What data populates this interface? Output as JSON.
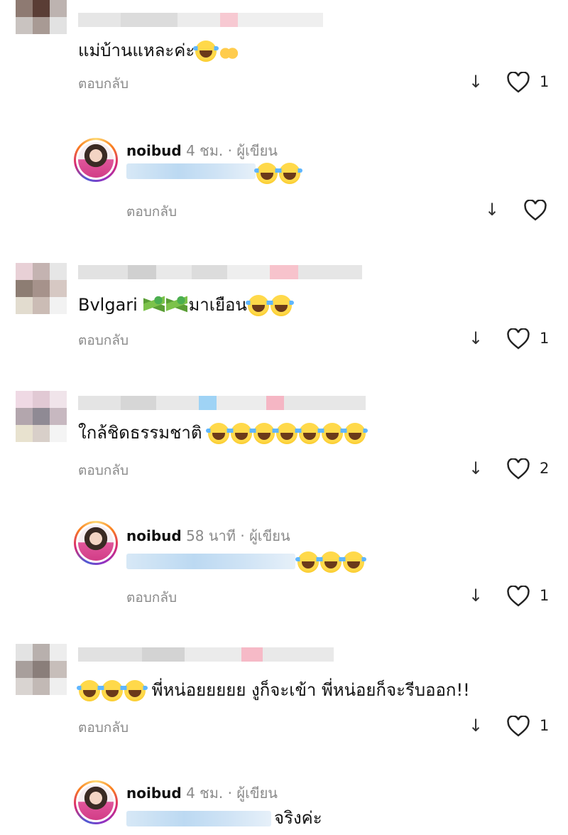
{
  "labels": {
    "reply": "ตอบกลับ"
  },
  "author": {
    "username": "noibud",
    "separator": "·",
    "badge": "ผู้เขียน"
  },
  "icons": {
    "down": "down-arrow-icon",
    "like": "heart-outline-icon",
    "laugh": "face-with-tears-of-joy-icon",
    "snake": "snake-icon",
    "raised_hands": "raising-hands-icon"
  },
  "colors": {
    "meta": "#8a8a8a",
    "mention_blur": "#bcd9f2",
    "ring_start": "#feda75",
    "ring_end": "#962fbf"
  },
  "comments": [
    {
      "text": "แม่บ้านแหละค่ะ",
      "likes": "1"
    },
    {
      "reply_time": "4 ชม.",
      "reply_likes": ""
    },
    {
      "text": "Bvlgari",
      "text2": "มาเยือน",
      "likes": "1"
    },
    {
      "text": "ใกล้ชิดธรรมชาติ",
      "likes": "2"
    },
    {
      "reply_time": "58 นาที",
      "reply_likes": "1"
    },
    {
      "text": "พี่หน่อยยยยย งูก็จะเข้า พี่หน่อยก็จะรีบออก!!",
      "likes": "1"
    },
    {
      "reply_time": "4 ชม.",
      "reply_text": "จริงค่ะ"
    }
  ]
}
